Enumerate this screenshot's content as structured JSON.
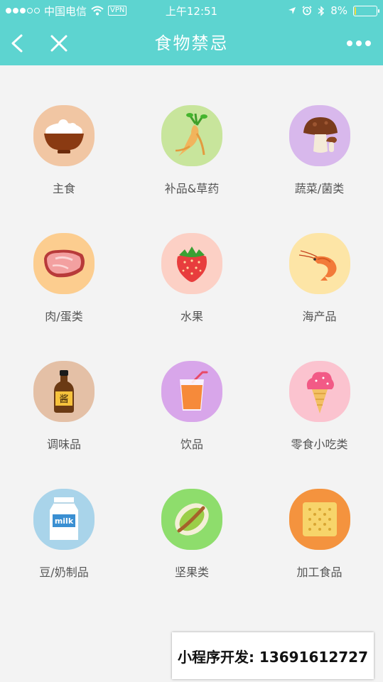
{
  "status": {
    "carrier": "中国电信",
    "vpn": "VPN",
    "time": "上午12:51",
    "battery_text": "8%",
    "battery_level": 0.08
  },
  "nav": {
    "title": "食物禁忌"
  },
  "categories": [
    {
      "label": "主食",
      "bg": "#f1c6a3",
      "icon": "rice-bowl-icon"
    },
    {
      "label": "补品&草药",
      "bg": "#c8e59c",
      "icon": "ginseng-icon"
    },
    {
      "label": "蔬菜/菌类",
      "bg": "#d8b8ec",
      "icon": "mushroom-icon"
    },
    {
      "label": "肉/蛋类",
      "bg": "#fccd8f",
      "icon": "meat-icon"
    },
    {
      "label": "水果",
      "bg": "#fcd0c5",
      "icon": "strawberry-icon"
    },
    {
      "label": "海产品",
      "bg": "#fde5a6",
      "icon": "shrimp-icon"
    },
    {
      "label": "调味品",
      "bg": "#e4c0a6",
      "icon": "sauce-bottle-icon"
    },
    {
      "label": "饮品",
      "bg": "#d8a6ea",
      "icon": "juice-cup-icon"
    },
    {
      "label": "零食小吃类",
      "bg": "#fbc3cf",
      "icon": "ice-cream-icon"
    },
    {
      "label": "豆/奶制品",
      "bg": "#a9d4ea",
      "icon": "milk-carton-icon"
    },
    {
      "label": "坚果类",
      "bg": "#8edd6c",
      "icon": "pistachio-icon"
    },
    {
      "label": "加工食品",
      "bg": "#f4933e",
      "icon": "biscuit-icon"
    }
  ],
  "watermark": {
    "text": "小程序开发: 13691612727"
  }
}
